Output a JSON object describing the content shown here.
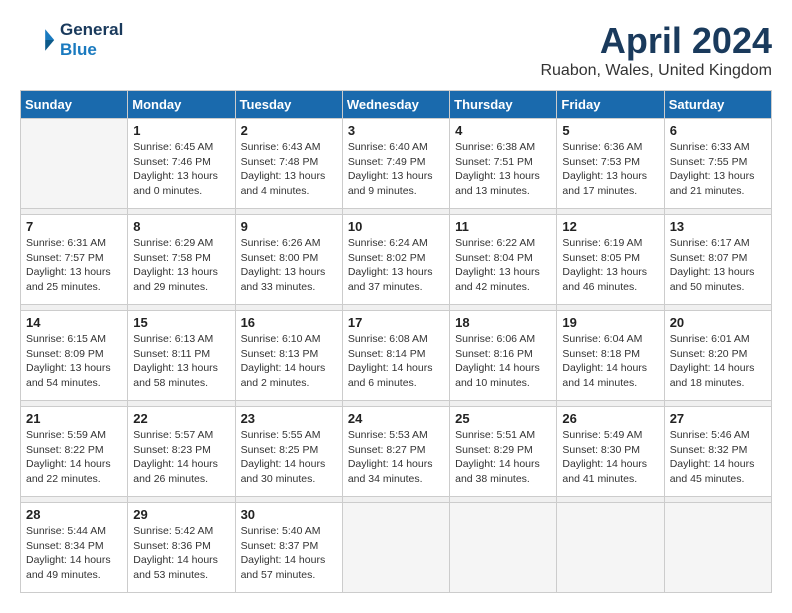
{
  "logo": {
    "line1": "General",
    "line2": "Blue"
  },
  "title": "April 2024",
  "location": "Ruabon, Wales, United Kingdom",
  "days_of_week": [
    "Sunday",
    "Monday",
    "Tuesday",
    "Wednesday",
    "Thursday",
    "Friday",
    "Saturday"
  ],
  "weeks": [
    [
      {
        "day": "",
        "empty": true
      },
      {
        "day": "1",
        "sunrise": "6:45 AM",
        "sunset": "7:46 PM",
        "daylight": "13 hours and 0 minutes."
      },
      {
        "day": "2",
        "sunrise": "6:43 AM",
        "sunset": "7:48 PM",
        "daylight": "13 hours and 4 minutes."
      },
      {
        "day": "3",
        "sunrise": "6:40 AM",
        "sunset": "7:49 PM",
        "daylight": "13 hours and 9 minutes."
      },
      {
        "day": "4",
        "sunrise": "6:38 AM",
        "sunset": "7:51 PM",
        "daylight": "13 hours and 13 minutes."
      },
      {
        "day": "5",
        "sunrise": "6:36 AM",
        "sunset": "7:53 PM",
        "daylight": "13 hours and 17 minutes."
      },
      {
        "day": "6",
        "sunrise": "6:33 AM",
        "sunset": "7:55 PM",
        "daylight": "13 hours and 21 minutes."
      }
    ],
    [
      {
        "day": "7",
        "sunrise": "6:31 AM",
        "sunset": "7:57 PM",
        "daylight": "13 hours and 25 minutes."
      },
      {
        "day": "8",
        "sunrise": "6:29 AM",
        "sunset": "7:58 PM",
        "daylight": "13 hours and 29 minutes."
      },
      {
        "day": "9",
        "sunrise": "6:26 AM",
        "sunset": "8:00 PM",
        "daylight": "13 hours and 33 minutes."
      },
      {
        "day": "10",
        "sunrise": "6:24 AM",
        "sunset": "8:02 PM",
        "daylight": "13 hours and 37 minutes."
      },
      {
        "day": "11",
        "sunrise": "6:22 AM",
        "sunset": "8:04 PM",
        "daylight": "13 hours and 42 minutes."
      },
      {
        "day": "12",
        "sunrise": "6:19 AM",
        "sunset": "8:05 PM",
        "daylight": "13 hours and 46 minutes."
      },
      {
        "day": "13",
        "sunrise": "6:17 AM",
        "sunset": "8:07 PM",
        "daylight": "13 hours and 50 minutes."
      }
    ],
    [
      {
        "day": "14",
        "sunrise": "6:15 AM",
        "sunset": "8:09 PM",
        "daylight": "13 hours and 54 minutes."
      },
      {
        "day": "15",
        "sunrise": "6:13 AM",
        "sunset": "8:11 PM",
        "daylight": "13 hours and 58 minutes."
      },
      {
        "day": "16",
        "sunrise": "6:10 AM",
        "sunset": "8:13 PM",
        "daylight": "14 hours and 2 minutes."
      },
      {
        "day": "17",
        "sunrise": "6:08 AM",
        "sunset": "8:14 PM",
        "daylight": "14 hours and 6 minutes."
      },
      {
        "day": "18",
        "sunrise": "6:06 AM",
        "sunset": "8:16 PM",
        "daylight": "14 hours and 10 minutes."
      },
      {
        "day": "19",
        "sunrise": "6:04 AM",
        "sunset": "8:18 PM",
        "daylight": "14 hours and 14 minutes."
      },
      {
        "day": "20",
        "sunrise": "6:01 AM",
        "sunset": "8:20 PM",
        "daylight": "14 hours and 18 minutes."
      }
    ],
    [
      {
        "day": "21",
        "sunrise": "5:59 AM",
        "sunset": "8:22 PM",
        "daylight": "14 hours and 22 minutes."
      },
      {
        "day": "22",
        "sunrise": "5:57 AM",
        "sunset": "8:23 PM",
        "daylight": "14 hours and 26 minutes."
      },
      {
        "day": "23",
        "sunrise": "5:55 AM",
        "sunset": "8:25 PM",
        "daylight": "14 hours and 30 minutes."
      },
      {
        "day": "24",
        "sunrise": "5:53 AM",
        "sunset": "8:27 PM",
        "daylight": "14 hours and 34 minutes."
      },
      {
        "day": "25",
        "sunrise": "5:51 AM",
        "sunset": "8:29 PM",
        "daylight": "14 hours and 38 minutes."
      },
      {
        "day": "26",
        "sunrise": "5:49 AM",
        "sunset": "8:30 PM",
        "daylight": "14 hours and 41 minutes."
      },
      {
        "day": "27",
        "sunrise": "5:46 AM",
        "sunset": "8:32 PM",
        "daylight": "14 hours and 45 minutes."
      }
    ],
    [
      {
        "day": "28",
        "sunrise": "5:44 AM",
        "sunset": "8:34 PM",
        "daylight": "14 hours and 49 minutes."
      },
      {
        "day": "29",
        "sunrise": "5:42 AM",
        "sunset": "8:36 PM",
        "daylight": "14 hours and 53 minutes."
      },
      {
        "day": "30",
        "sunrise": "5:40 AM",
        "sunset": "8:37 PM",
        "daylight": "14 hours and 57 minutes."
      },
      {
        "day": "",
        "empty": true
      },
      {
        "day": "",
        "empty": true
      },
      {
        "day": "",
        "empty": true
      },
      {
        "day": "",
        "empty": true
      }
    ]
  ],
  "labels": {
    "sunrise_prefix": "Sunrise: ",
    "sunset_prefix": "Sunset: ",
    "daylight_prefix": "Daylight: "
  }
}
